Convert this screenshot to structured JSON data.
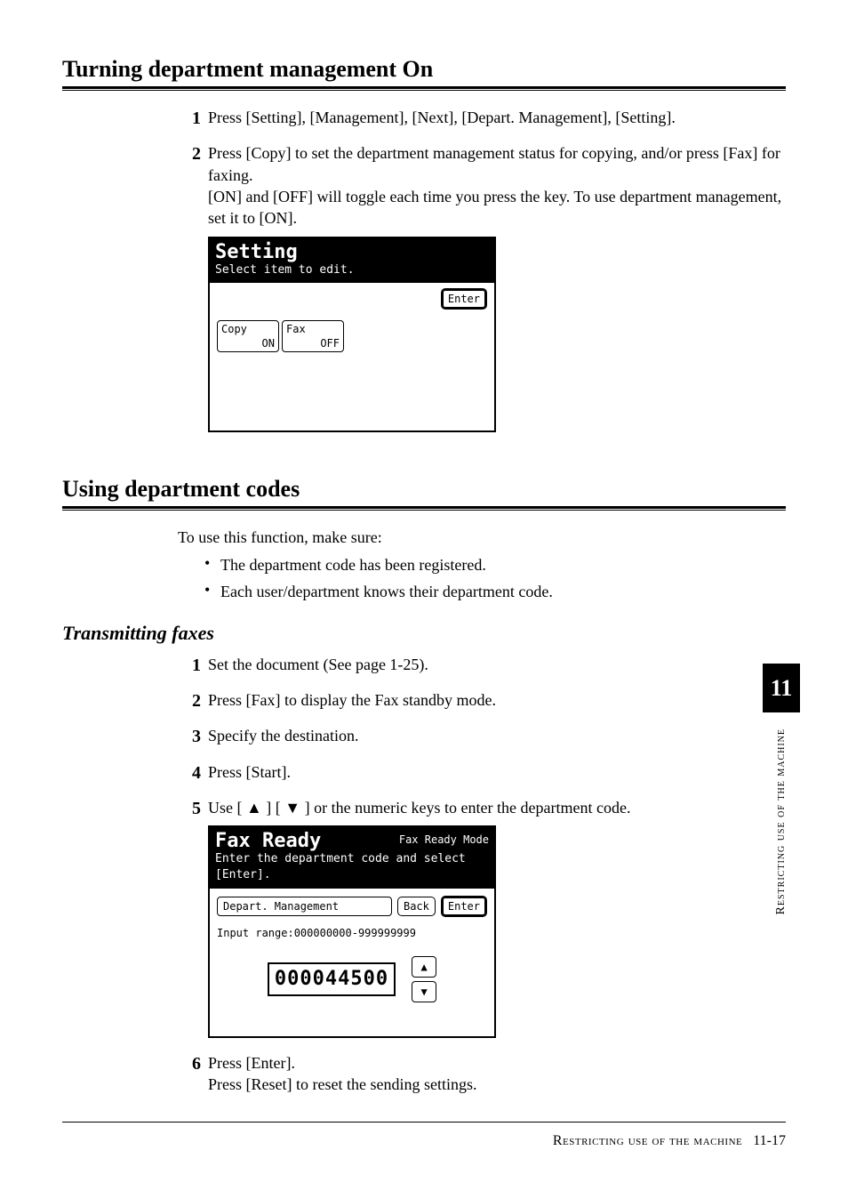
{
  "sideTab": {
    "number": "11",
    "label": "Restricting use of the machine"
  },
  "section1": {
    "heading": "Turning department management On",
    "steps": [
      {
        "num": "1",
        "text": "Press [Setting], [Management], [Next], [Depart. Management], [Setting]."
      },
      {
        "num": "2",
        "text": "Press [Copy] to set the department management status for copying, and/or press [Fax] for faxing.",
        "text2": "[ON] and [OFF] will toggle each time you press the key. To use department management, set it to [ON]."
      }
    ],
    "panel": {
      "title": "Setting",
      "subtitle": "Select item to edit.",
      "enter": "Enter",
      "toggles": [
        {
          "label": "Copy",
          "state": "ON"
        },
        {
          "label": "Fax",
          "state": "OFF"
        }
      ]
    }
  },
  "section2": {
    "heading": "Using department codes",
    "intro": "To use this function, make sure:",
    "bullets": [
      "The department code has been registered.",
      "Each user/department knows their department code."
    ]
  },
  "sub1": {
    "heading": "Transmitting faxes",
    "steps": [
      {
        "num": "1",
        "text": "Set the document (See page 1-25)."
      },
      {
        "num": "2",
        "text": "Press [Fax] to display the Fax standby mode."
      },
      {
        "num": "3",
        "text": "Specify the destination."
      },
      {
        "num": "4",
        "text": "Press [Start]."
      },
      {
        "num": "5",
        "text": "Use [ ▲ ]  [ ▼ ] or the numeric keys to enter the department code."
      },
      {
        "num": "6",
        "text": "Press [Enter].",
        "text2": "Press [Reset] to reset the sending settings."
      }
    ],
    "panel": {
      "title": "Fax Ready",
      "mode": "Fax Ready Mode",
      "subtitle": "Enter the department code and select [Enter].",
      "fieldLabel": "Depart. Management",
      "back": "Back",
      "enter": "Enter",
      "range": "Input range:000000000-999999999",
      "code": "000044500"
    }
  },
  "footer": {
    "section": "Restricting use of the machine",
    "page": "11-17"
  }
}
